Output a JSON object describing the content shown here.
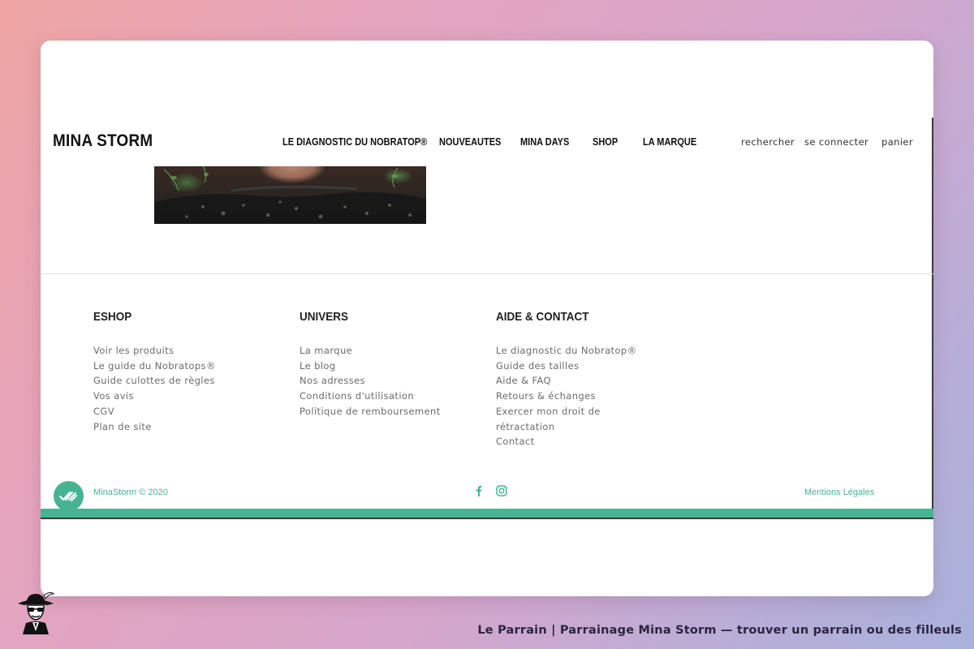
{
  "header": {
    "logo": "MINA STORM",
    "nav": [
      {
        "label": "LE DIAGNOSTIC DU NOBRATOP®"
      },
      {
        "label": "NOUVEAUTES"
      },
      {
        "label": "MINA DAYS"
      },
      {
        "label": "SHOP"
      },
      {
        "label": "LA MARQUE"
      }
    ],
    "utility": [
      {
        "label": "rechercher"
      },
      {
        "label": "se connecter"
      },
      {
        "label": "panier"
      }
    ]
  },
  "footer": {
    "columns": [
      {
        "title": "ESHOP",
        "links": [
          "Voir les produits",
          "Le guide du Nobratops®",
          "Guide culottes de règles",
          "Vos avis",
          "CGV",
          "Plan de site"
        ]
      },
      {
        "title": "UNIVERS",
        "links": [
          "La marque",
          "Le blog",
          "Nos adresses",
          "Conditions d'utilisation",
          "Politique de remboursement"
        ]
      },
      {
        "title": "AIDE & CONTACT",
        "links": [
          "Le diagnostic du Nobratop®",
          "Guide des tailles",
          "Aide & FAQ",
          "Retours & échanges",
          "Exercer mon droit de",
          "rétractation",
          "Contact"
        ]
      }
    ],
    "copyright": "MinaStorm © 2020",
    "legal": "Mentions Légales",
    "social_icons": [
      "facebook-icon",
      "instagram-icon"
    ]
  },
  "caption": "Le Parrain | Parrainage Mina Storm — trouver un parrain ou des filleuls",
  "colors": {
    "accent": "#46b393",
    "text_dark": "#111111",
    "text_muted": "#6b6b6b"
  }
}
